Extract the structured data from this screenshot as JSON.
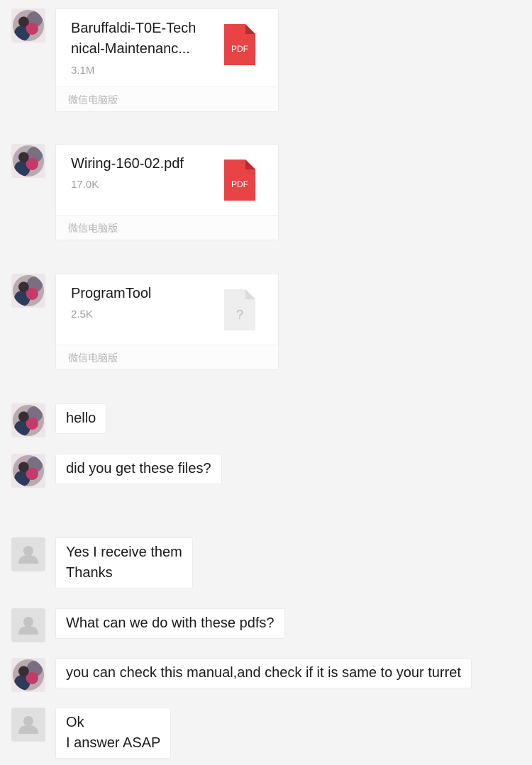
{
  "messages": [
    {
      "type": "file",
      "avatar": "user-photo",
      "name_line1": "Baruffaldi-T0E-Tech",
      "name_line2": "nical-Maintenanc...",
      "size": "3.1M",
      "icon": "pdf-icon",
      "icon_label": "PDF",
      "source": "微信电脑版"
    },
    {
      "type": "file",
      "avatar": "user-photo",
      "name_line1": "Wiring-160-02.pdf",
      "name_line2": "",
      "size": "17.0K",
      "icon": "pdf-icon",
      "icon_label": "PDF",
      "source": "微信电脑版"
    },
    {
      "type": "file",
      "avatar": "user-photo",
      "name_line1": "ProgramTool",
      "name_line2": "",
      "size": "2.5K",
      "icon": "unknown-file-icon",
      "icon_label": "?",
      "source": "微信电脑版"
    },
    {
      "type": "text",
      "avatar": "user-photo",
      "lines": [
        "hello"
      ]
    },
    {
      "type": "text",
      "avatar": "user-photo",
      "lines": [
        "did you get these files?"
      ]
    },
    {
      "type": "text",
      "avatar": "default-avatar",
      "lines": [
        "Yes I receive them",
        "Thanks"
      ]
    },
    {
      "type": "text",
      "avatar": "default-avatar",
      "lines": [
        "What can we do with these pdfs?"
      ]
    },
    {
      "type": "text",
      "avatar": "user-photo",
      "lines": [
        "you can check this manual,and check if it is same to your turret"
      ]
    },
    {
      "type": "text",
      "avatar": "default-avatar",
      "lines": [
        "Ok",
        "I answer ASAP"
      ]
    }
  ],
  "colors": {
    "background": "#f4f4f4",
    "bubble": "#ffffff",
    "pdf_red": "#e84446",
    "unknown_file": "#eeeeee"
  }
}
